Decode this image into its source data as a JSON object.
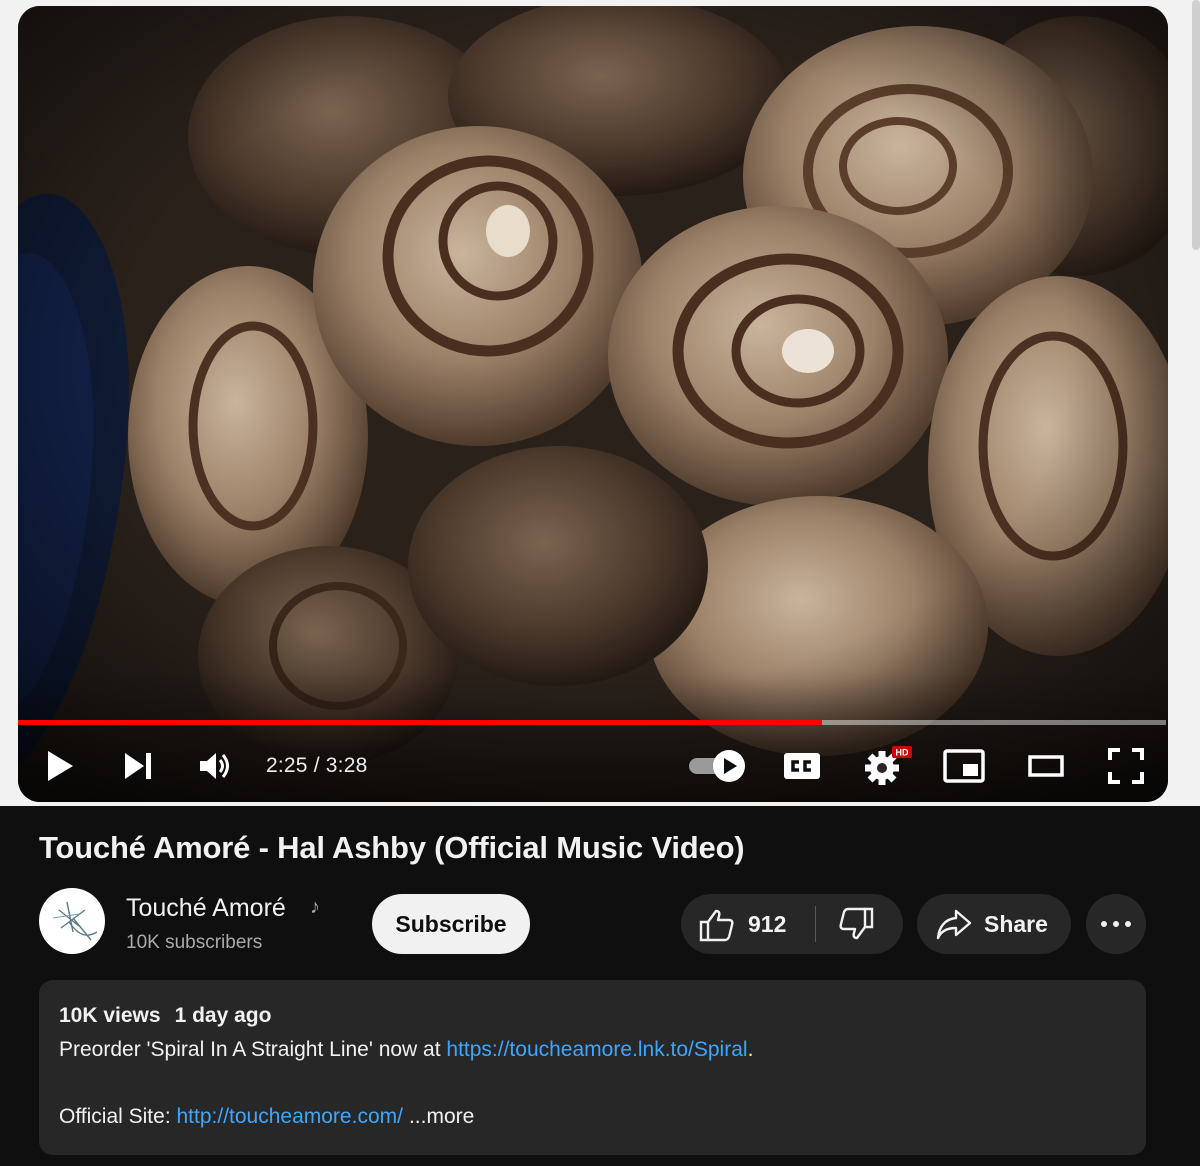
{
  "player": {
    "progress_fraction": 0.7,
    "current_time": "2:25",
    "duration": "3:28",
    "time_display": "2:25 / 3:28",
    "hd_badge": "HD",
    "icons": [
      "play-icon",
      "next-icon",
      "volume-icon",
      "autoplay-toggle-icon",
      "cc-icon",
      "settings-icon",
      "miniplayer-icon",
      "theater-icon",
      "fullscreen-icon"
    ],
    "colors": {
      "progress": "#ff0000",
      "hd_badge": "#cc0000"
    }
  },
  "video": {
    "title": "Touché Amoré - Hal Ashby (Official Music Video)"
  },
  "channel": {
    "name": "Touché Amoré",
    "note_icon": "♪",
    "subscribers": "10K subscribers",
    "subscribe_label": "Subscribe"
  },
  "actions": {
    "like_count": "912",
    "share_label": "Share",
    "more_icon": "more-horizontal-icon"
  },
  "description": {
    "views": "10K views",
    "age": "1 day ago",
    "line1_text": "Preorder 'Spiral In A Straight Line' now at ",
    "line1_link": "https://toucheamore.lnk.to/Spiral",
    "line1_end": ".",
    "line2_text": "Official Site: ",
    "line2_link": "http://toucheamore.com/",
    "more_label": "...more"
  },
  "theme": {
    "background": "#0f0f0f",
    "surface": "#272727",
    "link": "#3ea6ff"
  }
}
